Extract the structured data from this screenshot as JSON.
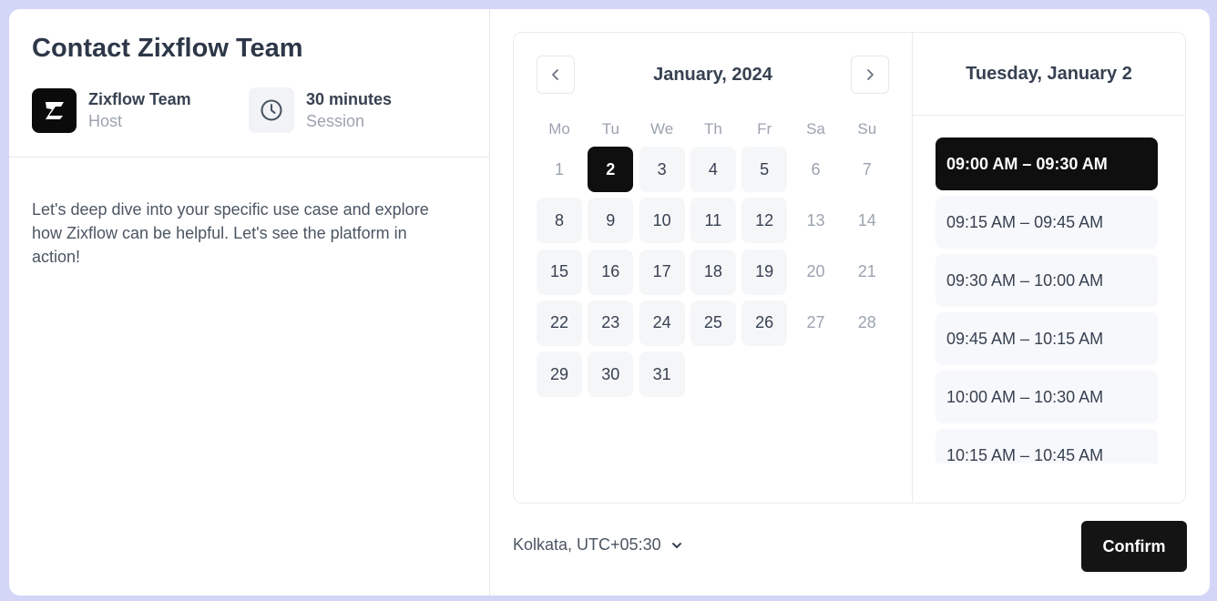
{
  "event": {
    "title": "Contact Zixflow Team",
    "host_name": "Zixflow Team",
    "host_label": "Host",
    "duration": "30 minutes",
    "duration_label": "Session",
    "description": "Let's deep dive into your specific use case and explore how Zixflow can be helpful. Let's see the platform in action!"
  },
  "calendar": {
    "month_label": "January, 2024",
    "weekdays": [
      "Mo",
      "Tu",
      "We",
      "Th",
      "Fr",
      "Sa",
      "Su"
    ],
    "days": [
      {
        "n": "1",
        "s": "dis"
      },
      {
        "n": "2",
        "s": "sel"
      },
      {
        "n": "3",
        "s": ""
      },
      {
        "n": "4",
        "s": ""
      },
      {
        "n": "5",
        "s": ""
      },
      {
        "n": "6",
        "s": "dis"
      },
      {
        "n": "7",
        "s": "dis"
      },
      {
        "n": "8",
        "s": ""
      },
      {
        "n": "9",
        "s": ""
      },
      {
        "n": "10",
        "s": ""
      },
      {
        "n": "11",
        "s": ""
      },
      {
        "n": "12",
        "s": ""
      },
      {
        "n": "13",
        "s": "dis"
      },
      {
        "n": "14",
        "s": "dis"
      },
      {
        "n": "15",
        "s": ""
      },
      {
        "n": "16",
        "s": ""
      },
      {
        "n": "17",
        "s": ""
      },
      {
        "n": "18",
        "s": ""
      },
      {
        "n": "19",
        "s": ""
      },
      {
        "n": "20",
        "s": "dis"
      },
      {
        "n": "21",
        "s": "dis"
      },
      {
        "n": "22",
        "s": ""
      },
      {
        "n": "23",
        "s": ""
      },
      {
        "n": "24",
        "s": ""
      },
      {
        "n": "25",
        "s": ""
      },
      {
        "n": "26",
        "s": ""
      },
      {
        "n": "27",
        "s": "dis"
      },
      {
        "n": "28",
        "s": "dis"
      },
      {
        "n": "29",
        "s": ""
      },
      {
        "n": "30",
        "s": ""
      },
      {
        "n": "31",
        "s": ""
      }
    ]
  },
  "times": {
    "selected_date": "Tuesday, January 2",
    "slots": [
      {
        "label": "09:00 AM – 09:30 AM",
        "selected": true
      },
      {
        "label": "09:15 AM – 09:45 AM",
        "selected": false
      },
      {
        "label": "09:30 AM – 10:00 AM",
        "selected": false
      },
      {
        "label": "09:45 AM – 10:15 AM",
        "selected": false
      },
      {
        "label": "10:00 AM – 10:30 AM",
        "selected": false
      },
      {
        "label": "10:15 AM – 10:45 AM",
        "selected": false
      }
    ]
  },
  "footer": {
    "timezone": "Kolkata, UTC+05:30",
    "confirm_label": "Confirm"
  },
  "icons": {
    "prev": "chevron-left-icon",
    "next": "chevron-right-icon",
    "clock": "clock-icon",
    "logo": "zixflow-logo-icon",
    "tz": "chevron-down-icon"
  },
  "colors": {
    "background": "#d3d6f7",
    "accent": "#0f0f0f",
    "muted": "#9ca3af"
  }
}
